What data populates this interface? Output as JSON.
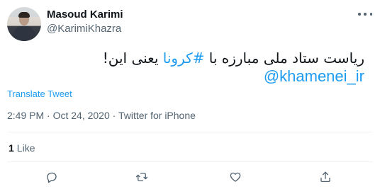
{
  "author": {
    "name": "Masoud Karimi",
    "handle": "@KarimiKhazra"
  },
  "tweet": {
    "text_before": "ریاست ستاد ملی مبارزه با ",
    "hashtag": "#کرونا",
    "text_after": " یعنی این!",
    "mention": "@khamenei_ir",
    "translate_label": "Translate Tweet",
    "time": "2:49 PM",
    "separator": " · ",
    "date": "Oct 24, 2020",
    "source": "Twitter for iPhone"
  },
  "stats": {
    "likes_count": "1",
    "likes_label": "Like"
  },
  "icons": {
    "more": "more-dots-icon",
    "reply": "reply-icon",
    "retweet": "retweet-icon",
    "like": "heart-icon",
    "share": "share-icon"
  },
  "colors": {
    "accent": "#1d9bf0",
    "text": "#0f1419",
    "muted": "#536471"
  }
}
